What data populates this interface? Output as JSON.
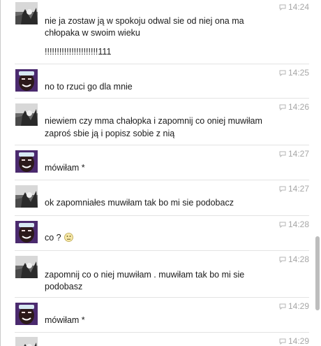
{
  "messages": [
    {
      "sender": "friend",
      "time": "14:24",
      "lines": [
        "nie ja zostaw ją w spokoju  odwal sie od niej ona ma",
        "chłopaka w swoim wieku",
        "!!!!!!!!!!!!!!!!!!!!!!111"
      ]
    },
    {
      "sender": "me",
      "time": "14:25",
      "lines": [
        "no to rzuci go dla mnie"
      ]
    },
    {
      "sender": "friend",
      "time": "14:26",
      "lines": [
        "niewiem czy mma chałopka i zapomnij co oniej muwiłam",
        "zaproś sbie ją i popisz sobie z nią"
      ]
    },
    {
      "sender": "me",
      "time": "14:27",
      "lines": [
        "mówiłam *"
      ]
    },
    {
      "sender": "friend",
      "time": "14:27",
      "lines": [
        "ok zapomniałes muwiłam tak bo mi sie podobacz"
      ]
    },
    {
      "sender": "me",
      "time": "14:28",
      "lines": [
        "co ?"
      ],
      "emoji": "slight-frown-emoji"
    },
    {
      "sender": "friend",
      "time": "14:28",
      "lines": [
        "zapomnij co o niej muwiłam . muwiłam tak bo mi sie",
        "podobasz"
      ]
    },
    {
      "sender": "me",
      "time": "14:29",
      "lines": [
        "mówiłam *"
      ]
    },
    {
      "sender": "friend",
      "time": "14:29",
      "lines": []
    }
  ],
  "colors": {
    "timestamp": "#a6a6a6",
    "separator": "#e3e3e3",
    "scroll_thumb": "#bdbdbd"
  },
  "icons": {
    "timestamp": "chat-bubble-icon",
    "avatar_friend": "friend-avatar",
    "avatar_me": "user-avatar"
  }
}
